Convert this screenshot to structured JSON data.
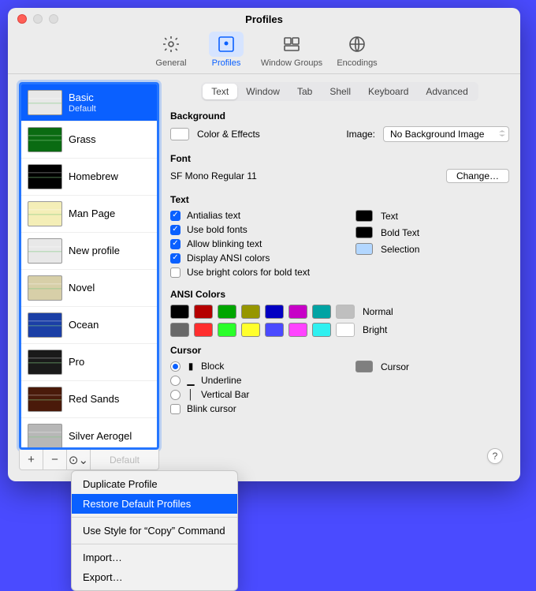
{
  "window": {
    "title": "Profiles"
  },
  "toolbar": {
    "items": [
      {
        "label": "General"
      },
      {
        "label": "Profiles"
      },
      {
        "label": "Window Groups"
      },
      {
        "label": "Encodings"
      }
    ]
  },
  "sidebar": {
    "profiles": [
      {
        "name": "Basic",
        "subtitle": "Default",
        "thumb_bg": "#e8e8e8"
      },
      {
        "name": "Grass",
        "thumb_bg": "#0a6b12"
      },
      {
        "name": "Homebrew",
        "thumb_bg": "#000000"
      },
      {
        "name": "Man Page",
        "thumb_bg": "#f4eeb7"
      },
      {
        "name": "New profile",
        "thumb_bg": "#e8e8e8"
      },
      {
        "name": "Novel",
        "thumb_bg": "#d7cfa8"
      },
      {
        "name": "Ocean",
        "thumb_bg": "#1b3fa6"
      },
      {
        "name": "Pro",
        "thumb_bg": "#1a1a1a"
      },
      {
        "name": "Red Sands",
        "thumb_bg": "#4a1a0a"
      },
      {
        "name": "Silver Aerogel",
        "thumb_bg": "#b7b7b7"
      }
    ],
    "buttons": {
      "add": "+",
      "remove": "−",
      "more": "⊙",
      "default": "Default"
    }
  },
  "tabs": [
    "Text",
    "Window",
    "Tab",
    "Shell",
    "Keyboard",
    "Advanced"
  ],
  "background": {
    "heading": "Background",
    "color_effects": "Color & Effects",
    "image_label": "Image:",
    "image_popup": "No Background Image"
  },
  "font": {
    "heading": "Font",
    "value": "SF Mono Regular 11",
    "change_button": "Change…"
  },
  "text": {
    "heading": "Text",
    "antialias": "Antialias text",
    "bold_fonts": "Use bold fonts",
    "blinking": "Allow blinking text",
    "ansi": "Display ANSI colors",
    "bright_bold": "Use bright colors for bold text",
    "well_text": "Text",
    "well_bold": "Bold Text",
    "well_selection": "Selection",
    "color_text": "#000000",
    "color_bold": "#000000",
    "color_selection": "#b3d7ff"
  },
  "ansi": {
    "heading": "ANSI Colors",
    "normal_label": "Normal",
    "bright_label": "Bright",
    "normal": [
      "#000000",
      "#b50000",
      "#00a600",
      "#969600",
      "#0200c2",
      "#c700c7",
      "#00a3a3",
      "#bfbfbf"
    ],
    "bright": [
      "#686868",
      "#ff2e2e",
      "#2aff2a",
      "#ffff2c",
      "#4a4aff",
      "#ff44ff",
      "#2ff0f0",
      "#ffffff"
    ]
  },
  "cursor": {
    "heading": "Cursor",
    "block": "Block",
    "underline": "Underline",
    "bar": "Vertical Bar",
    "blink": "Blink cursor",
    "well_label": "Cursor",
    "well_color": "#7f7f7f"
  },
  "help": "?",
  "menu": {
    "duplicate": "Duplicate Profile",
    "restore": "Restore Default Profiles",
    "copy_style": "Use Style for “Copy” Command",
    "import": "Import…",
    "export": "Export…"
  }
}
